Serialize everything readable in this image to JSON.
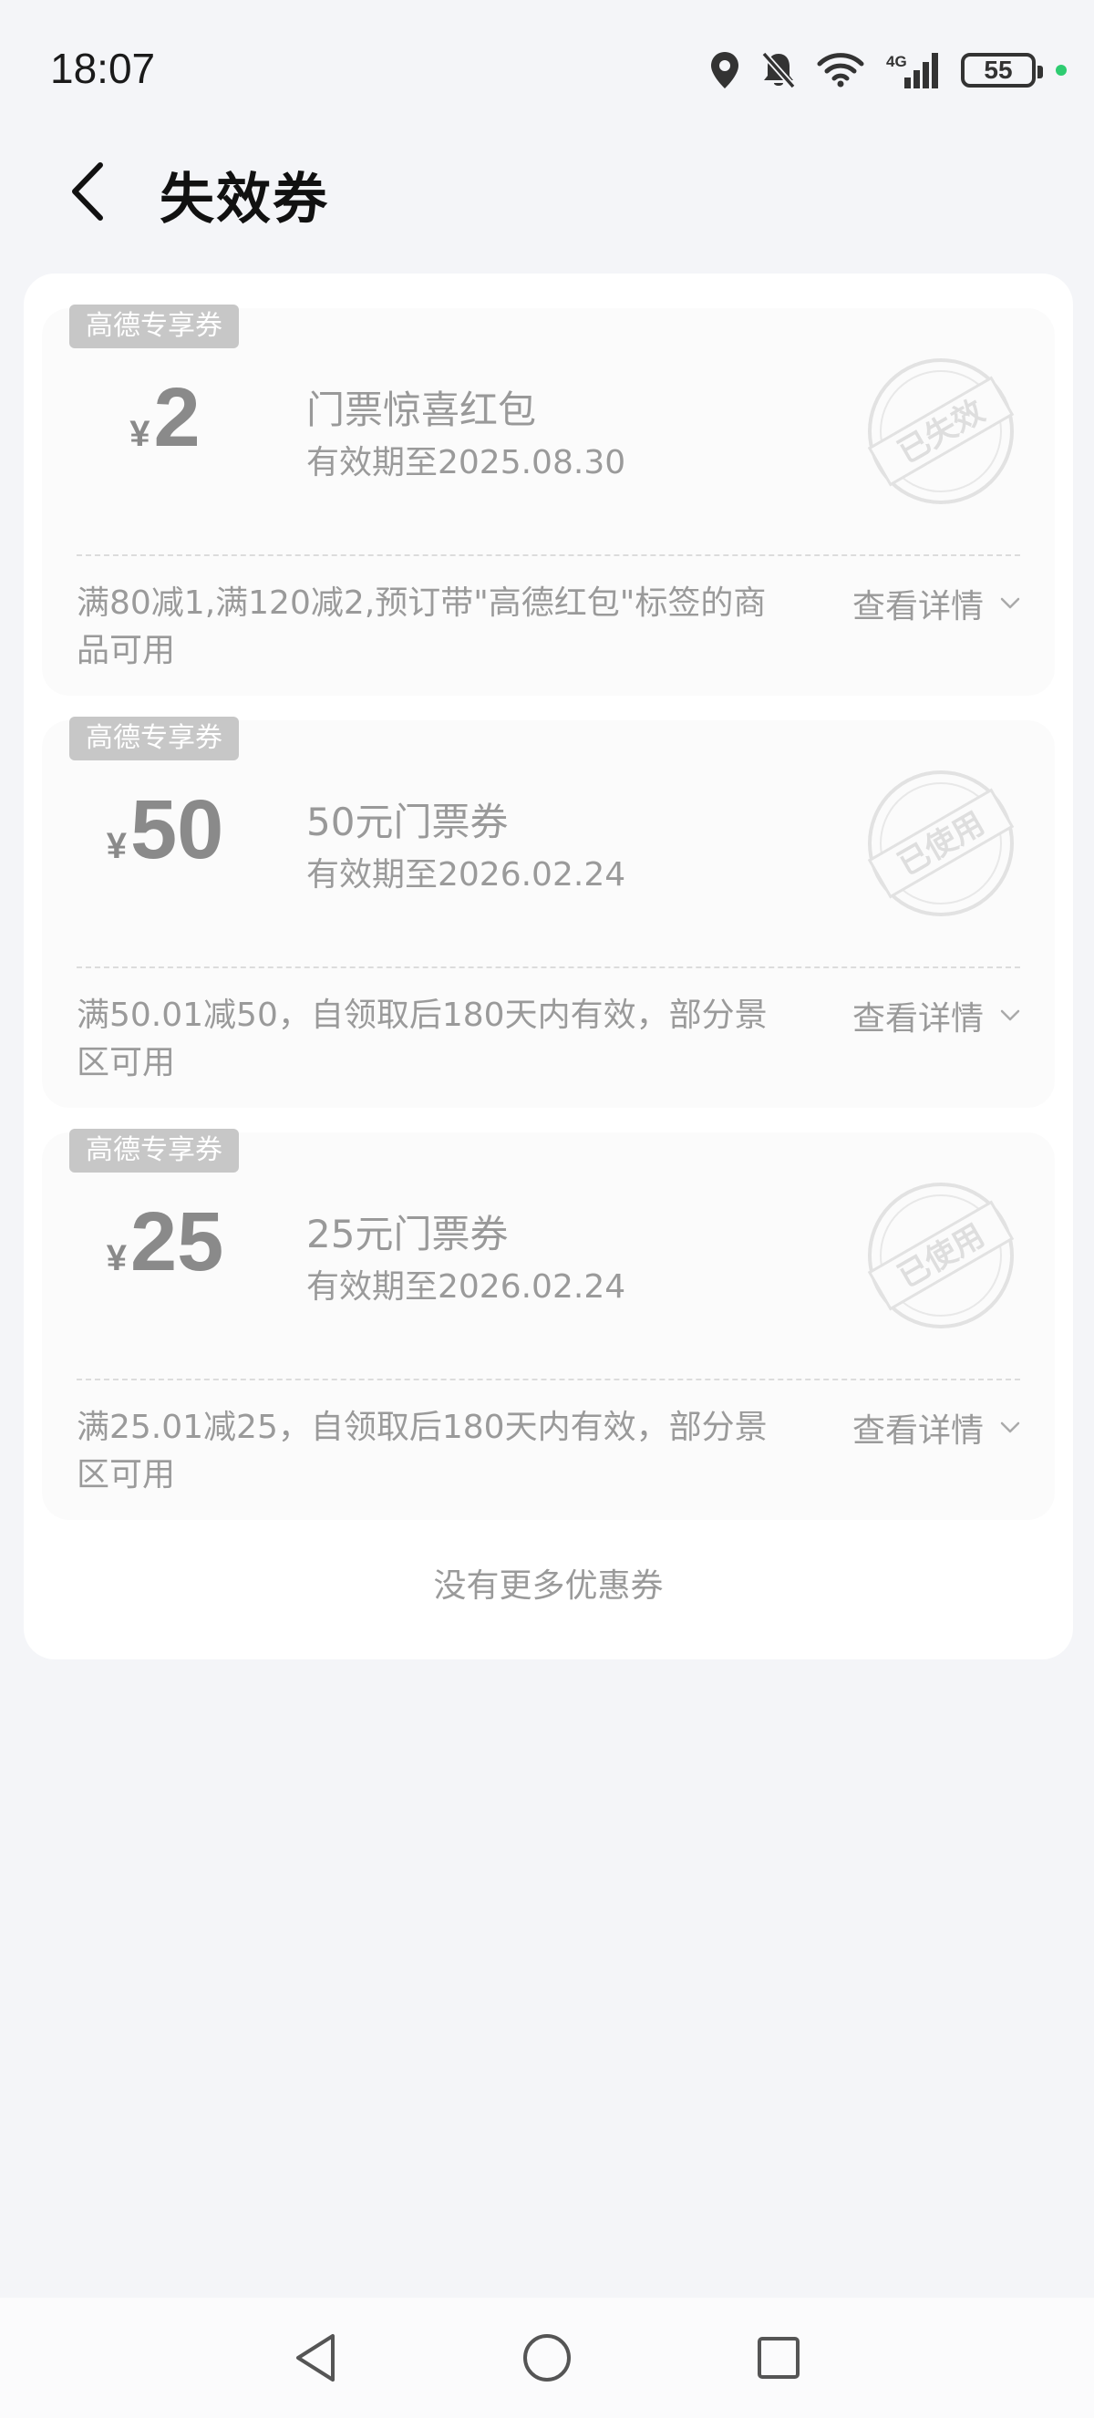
{
  "status_bar": {
    "time": "18:07",
    "network": "4G",
    "battery": "55",
    "icons": [
      "location-icon",
      "bell-muted-icon",
      "wifi-icon",
      "signal-icon",
      "battery-icon"
    ]
  },
  "header": {
    "title": "失效券"
  },
  "coupons": [
    {
      "tag": "高德专享券",
      "currency": "¥",
      "amount": "2",
      "name": "门票惊喜红包",
      "validity": "有效期至2025.08.30",
      "stamp": "已失效",
      "rule": "满80减1,满120减2,预订带\"高德红包\"标签的商品可用",
      "detail_label": "查看详情"
    },
    {
      "tag": "高德专享券",
      "currency": "¥",
      "amount": "50",
      "name": "50元门票券",
      "validity": "有效期至2026.02.24",
      "stamp": "已使用",
      "rule": "满50.01减50，自领取后180天内有效，部分景区可用",
      "detail_label": "查看详情"
    },
    {
      "tag": "高德专享券",
      "currency": "¥",
      "amount": "25",
      "name": "25元门票券",
      "validity": "有效期至2026.02.24",
      "stamp": "已使用",
      "rule": "满25.01减25，自领取后180天内有效，部分景区可用",
      "detail_label": "查看详情"
    }
  ],
  "footer": {
    "no_more": "没有更多优惠券"
  },
  "colors": {
    "background": "#f4f5f8",
    "card": "#ffffff",
    "coupon_bg": "#fbfbfb",
    "muted_text": "#9a9a9a",
    "tag_bg": "#c7c7c7",
    "indicator_green": "#2ecc71"
  }
}
